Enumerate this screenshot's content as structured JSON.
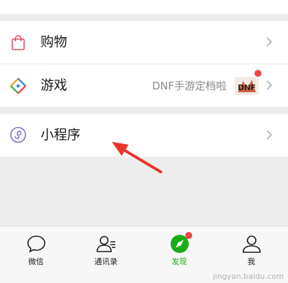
{
  "rows": [
    {
      "label": "购物",
      "icon": "shopping-bag-icon"
    },
    {
      "label": "游戏",
      "icon": "game-diamond-icon",
      "subtitle": "DNF手游定档啦",
      "thumbnail_text": "DNF"
    },
    {
      "label": "小程序",
      "icon": "mini-program-icon"
    }
  ],
  "tabs": [
    {
      "label": "微信",
      "icon": "chat-bubble-icon",
      "active": false
    },
    {
      "label": "通讯录",
      "icon": "contacts-icon",
      "active": false
    },
    {
      "label": "发现",
      "icon": "compass-icon",
      "active": true
    },
    {
      "label": "我",
      "icon": "person-icon",
      "active": false
    }
  ],
  "watermark": "jingyan.baidu.com",
  "colors": {
    "active_green": "#1aad19",
    "badge_red": "#f0434a",
    "annotation_arrow": "#e8352b"
  }
}
